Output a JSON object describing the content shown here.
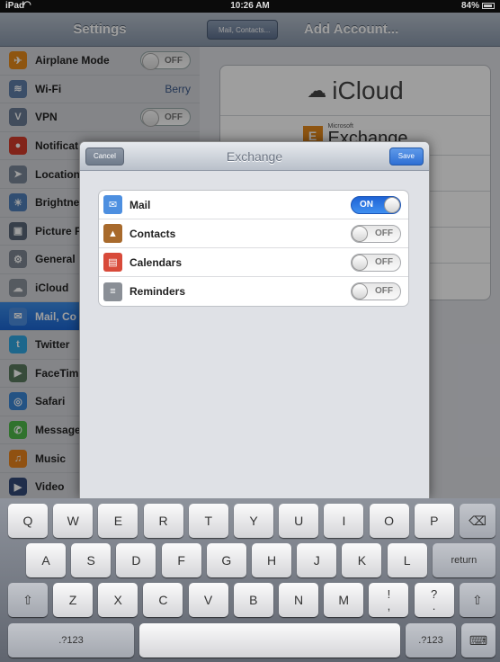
{
  "status_bar": {
    "carrier": "iPad",
    "wifi_icon": "wifi-icon",
    "time": "10:26 AM",
    "battery": "84%"
  },
  "settings": {
    "title": "Settings",
    "items": [
      {
        "label": "Airplane Mode",
        "icon": "airplane-icon",
        "color": "#e58a1b",
        "toggle": "OFF"
      },
      {
        "label": "Wi-Fi",
        "icon": "wifi-icon",
        "color": "#5f7ea8",
        "value": "Berry"
      },
      {
        "label": "VPN",
        "icon": "vpn-icon",
        "color": "#6a7b95",
        "toggle": "OFF"
      },
      {
        "label": "Notificat",
        "icon": "notifications-icon",
        "color": "#d23a2a"
      },
      {
        "label": "Location",
        "icon": "location-icon",
        "color": "#7a8798"
      },
      {
        "label": "Brightne",
        "icon": "brightness-icon",
        "color": "#4f7fb8"
      },
      {
        "label": "Picture F",
        "icon": "picture-frame-icon",
        "color": "#5a6778"
      },
      {
        "label": "General",
        "icon": "gear-icon",
        "color": "#7e8794"
      },
      {
        "label": "iCloud",
        "icon": "cloud-icon",
        "color": "#8a919c"
      },
      {
        "label": "Mail, Co",
        "icon": "mail-icon",
        "color": "#4d8fe0",
        "selected": true
      },
      {
        "label": "Twitter",
        "icon": "twitter-icon",
        "color": "#2fa7e3"
      },
      {
        "label": "FaceTim",
        "icon": "facetime-icon",
        "color": "#5a7a5e"
      },
      {
        "label": "Safari",
        "icon": "safari-icon",
        "color": "#3a86d6"
      },
      {
        "label": "Message",
        "icon": "messages-icon",
        "color": "#4eb84a"
      },
      {
        "label": "Music",
        "icon": "music-icon",
        "color": "#e8831c"
      },
      {
        "label": "Video",
        "icon": "video-icon",
        "color": "#334a78"
      }
    ]
  },
  "add_account": {
    "back_label": "Mail, Contacts...",
    "title": "Add Account...",
    "icloud_label": "iCloud",
    "exchange_ms_label": "Microsoft",
    "exchange_label": "Exchange"
  },
  "modal": {
    "title": "Exchange",
    "cancel_label": "Cancel",
    "save_label": "Save",
    "rows": [
      {
        "label": "Mail",
        "icon": "mail-icon",
        "color": "#4d8fe0",
        "state": "ON"
      },
      {
        "label": "Contacts",
        "icon": "contacts-icon",
        "color": "#a86a2c",
        "state": "OFF"
      },
      {
        "label": "Calendars",
        "icon": "calendar-icon",
        "color": "#d84a3a",
        "state": "OFF"
      },
      {
        "label": "Reminders",
        "icon": "reminders-icon",
        "color": "#8a8f96",
        "state": "OFF"
      }
    ]
  },
  "keyboard": {
    "row1": [
      "Q",
      "W",
      "E",
      "R",
      "T",
      "Y",
      "U",
      "I",
      "O",
      "P"
    ],
    "backspace_icon": "backspace-icon",
    "row2": [
      "A",
      "S",
      "D",
      "F",
      "G",
      "H",
      "J",
      "K",
      "L"
    ],
    "return_label": "return",
    "shift_icon": "shift-icon",
    "row3": [
      "Z",
      "X",
      "C",
      "V",
      "B",
      "N",
      "M"
    ],
    "punct1_top": "!",
    "punct1_bottom": ",",
    "punct2_top": "?",
    "punct2_bottom": ".",
    "numbers_label": ".?123",
    "hide_keyboard_icon": "keyboard-hide-icon"
  }
}
